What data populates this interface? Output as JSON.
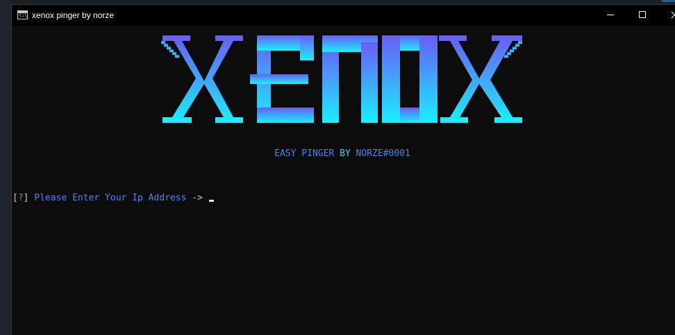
{
  "window": {
    "icon_text": "C:\\_",
    "title": "xenox pinger by norze",
    "minimize_label": "Minimize",
    "maximize_label": "Maximize",
    "close_label": "Close"
  },
  "console": {
    "logo_text": "xenox",
    "subtitle": {
      "part1": "EASY PINGER ",
      "by": "BY",
      "part2": " NORZE#0001"
    },
    "prompt": {
      "open_bracket": "[",
      "qmark": "?",
      "close_bracket": "]",
      "text": " Please Enter Your Ip Address ",
      "arrow": "->"
    },
    "input_value": ""
  },
  "colors": {
    "logo_top": "#6a5cf5",
    "logo_bottom": "#19f0ff",
    "prompt_blue": "#4f86e8",
    "subtitle_by": "#3ed0e8",
    "background": "#0c0c0c"
  }
}
